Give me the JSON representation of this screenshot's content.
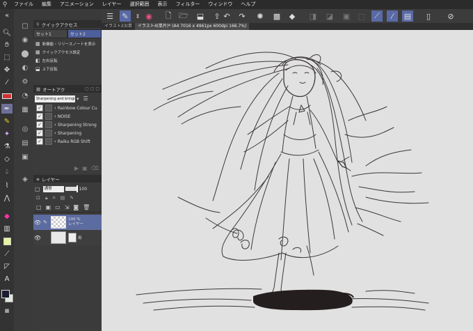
{
  "menu": {
    "items": [
      "ファイル",
      "編集",
      "アニメーション",
      "レイヤー",
      "選択範囲",
      "表示",
      "フィルター",
      "ウィンドウ",
      "ヘルプ"
    ]
  },
  "quick_access": {
    "tab_label": "クイックアクセス",
    "sets": [
      "セット1",
      "セット2"
    ],
    "items": [
      "新機能・リリースノートを表示",
      "クイックアクセス設定",
      "左右反転",
      "上下反転"
    ]
  },
  "auto_action": {
    "tab_label": "オートアク",
    "dropdown": "Sharpening and bringing",
    "items": [
      "Rainbow Colour Cu",
      "NOISE",
      "Sharpening Strong",
      "Sharpening",
      "Raiku RGB Shift"
    ]
  },
  "layer": {
    "tab_label": "レイヤー",
    "blend_mode": "通常",
    "opacity": "100",
    "layers": [
      {
        "opacity": "100 %",
        "name": "レイヤー"
      }
    ],
    "paper_label": "用"
  },
  "tabs": [
    {
      "label": "イラスト23(単"
    },
    {
      "label": "イラスト4(単片)* (A4 7016 x 4961px 600dpi 166.7%)"
    }
  ],
  "colors": {
    "main": "#1b1b33",
    "sub": "#dfe8df",
    "tool_selected": "#6f6f9a",
    "accent": "#5a6aa6"
  }
}
